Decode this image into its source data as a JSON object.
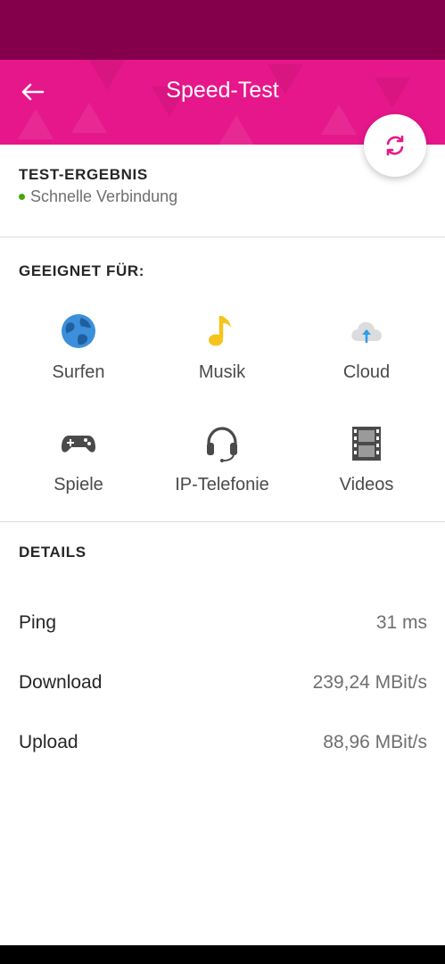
{
  "header": {
    "title": "Speed-Test"
  },
  "result": {
    "heading": "TEST-ERGEBNIS",
    "status": "Schnelle Verbindung",
    "status_color": "#46a800"
  },
  "suitable": {
    "heading": "GEEIGNET FÜR:",
    "items": [
      {
        "label": "Surfen",
        "icon": "globe-icon"
      },
      {
        "label": "Musik",
        "icon": "music-note-icon"
      },
      {
        "label": "Cloud",
        "icon": "cloud-upload-icon"
      },
      {
        "label": "Spiele",
        "icon": "gamepad-icon"
      },
      {
        "label": "IP-Telefonie",
        "icon": "headset-icon"
      },
      {
        "label": "Videos",
        "icon": "film-icon"
      }
    ]
  },
  "details": {
    "heading": "DETAILS",
    "rows": [
      {
        "label": "Ping",
        "value": "31 ms"
      },
      {
        "label": "Download",
        "value": "239,24 MBit/s"
      },
      {
        "label": "Upload",
        "value": "88,96 MBit/s"
      }
    ]
  },
  "colors": {
    "brand": "#e6178a",
    "status_bar": "#84004b"
  }
}
